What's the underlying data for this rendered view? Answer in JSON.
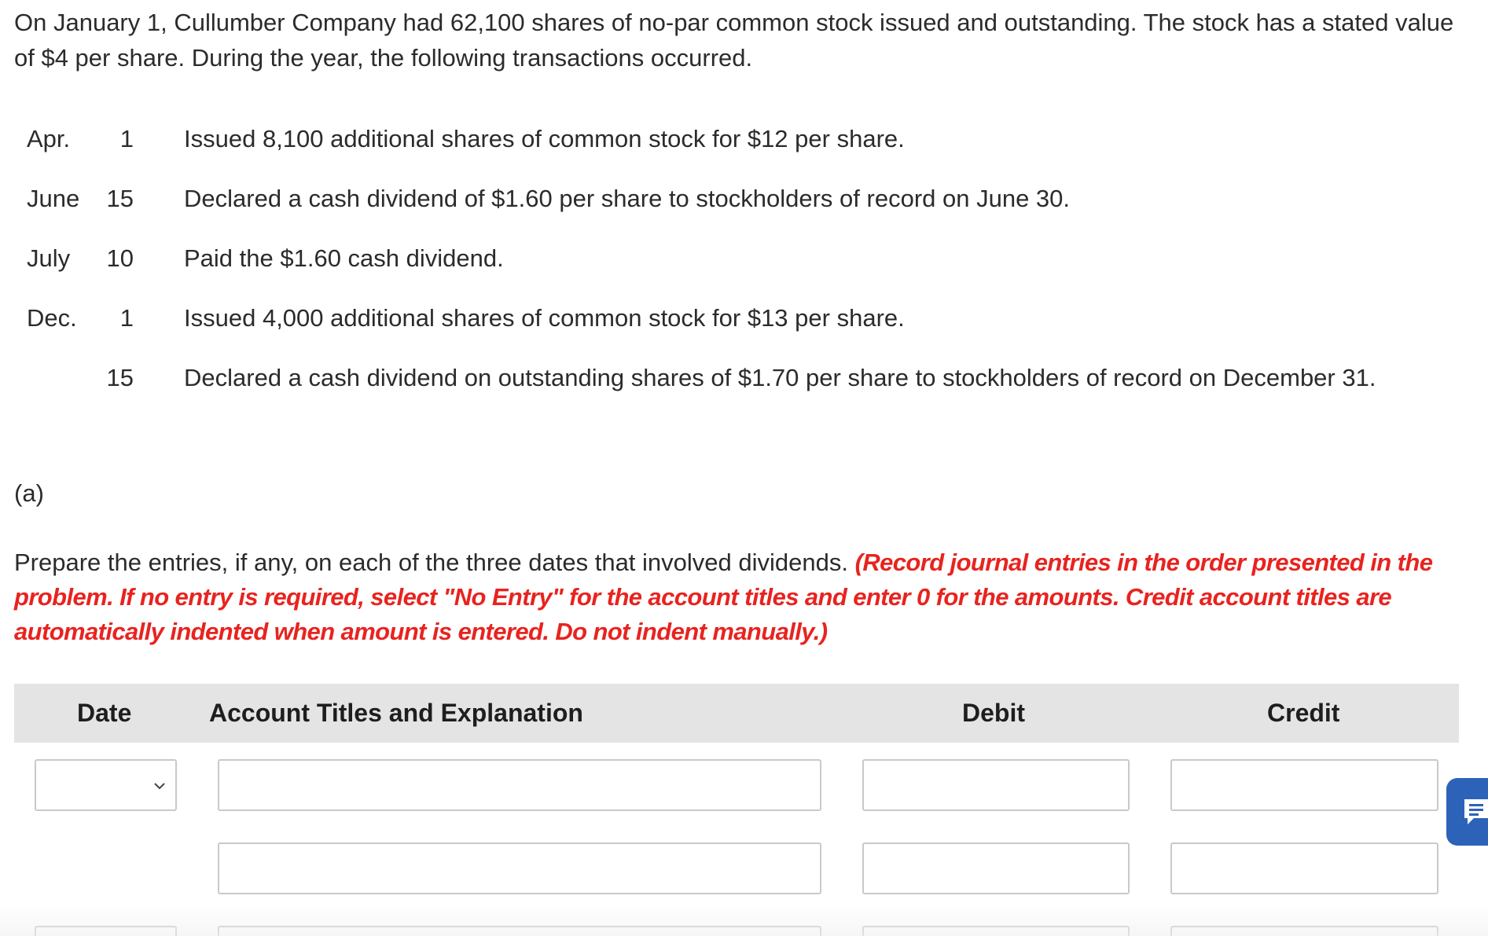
{
  "problem": {
    "intro": "On January 1, Cullumber Company had 62,100 shares of no-par common stock issued and outstanding. The stock has a stated value of $4 per share. During the year, the following transactions occurred."
  },
  "transactions": [
    {
      "month": "Apr.",
      "day": "1",
      "description": "Issued 8,100 additional shares of common stock for $12 per share."
    },
    {
      "month": "June",
      "day": "15",
      "description": "Declared a cash dividend of $1.60 per share to stockholders of record on June 30."
    },
    {
      "month": "July",
      "day": "10",
      "description": "Paid the $1.60 cash dividend."
    },
    {
      "month": "Dec.",
      "day": "1",
      "description": "Issued 4,000 additional shares of common stock for $13 per share."
    },
    {
      "month": "",
      "day": "15",
      "description": "Declared a cash dividend on outstanding shares of $1.70 per share to stockholders of record on December 31."
    }
  ],
  "part": {
    "label": "(a)",
    "prompt": "Prepare the entries, if any, on each of the three dates that involved dividends.",
    "instruction": "(Record journal entries in the order presented in the problem. If no entry is required, select \"No Entry\" for the account titles and enter 0 for the amounts. Credit account titles are automatically indented when amount is entered. Do not indent manually.)"
  },
  "journal_table": {
    "headers": {
      "date": "Date",
      "account": "Account Titles and Explanation",
      "debit": "Debit",
      "credit": "Credit"
    },
    "rows": [
      {
        "date": "",
        "account": "",
        "debit": "",
        "credit": ""
      },
      {
        "date": "",
        "account": "",
        "debit": "",
        "credit": ""
      },
      {
        "date": "",
        "account": "",
        "debit": "",
        "credit": ""
      }
    ]
  },
  "icons": {
    "date_dropdown": "chevron-down-icon",
    "feedback": "feedback-icon"
  },
  "colors": {
    "instruction_red": "#e8231f",
    "header_bg": "#e4e4e4",
    "feedback_blue": "#2c63b8"
  }
}
